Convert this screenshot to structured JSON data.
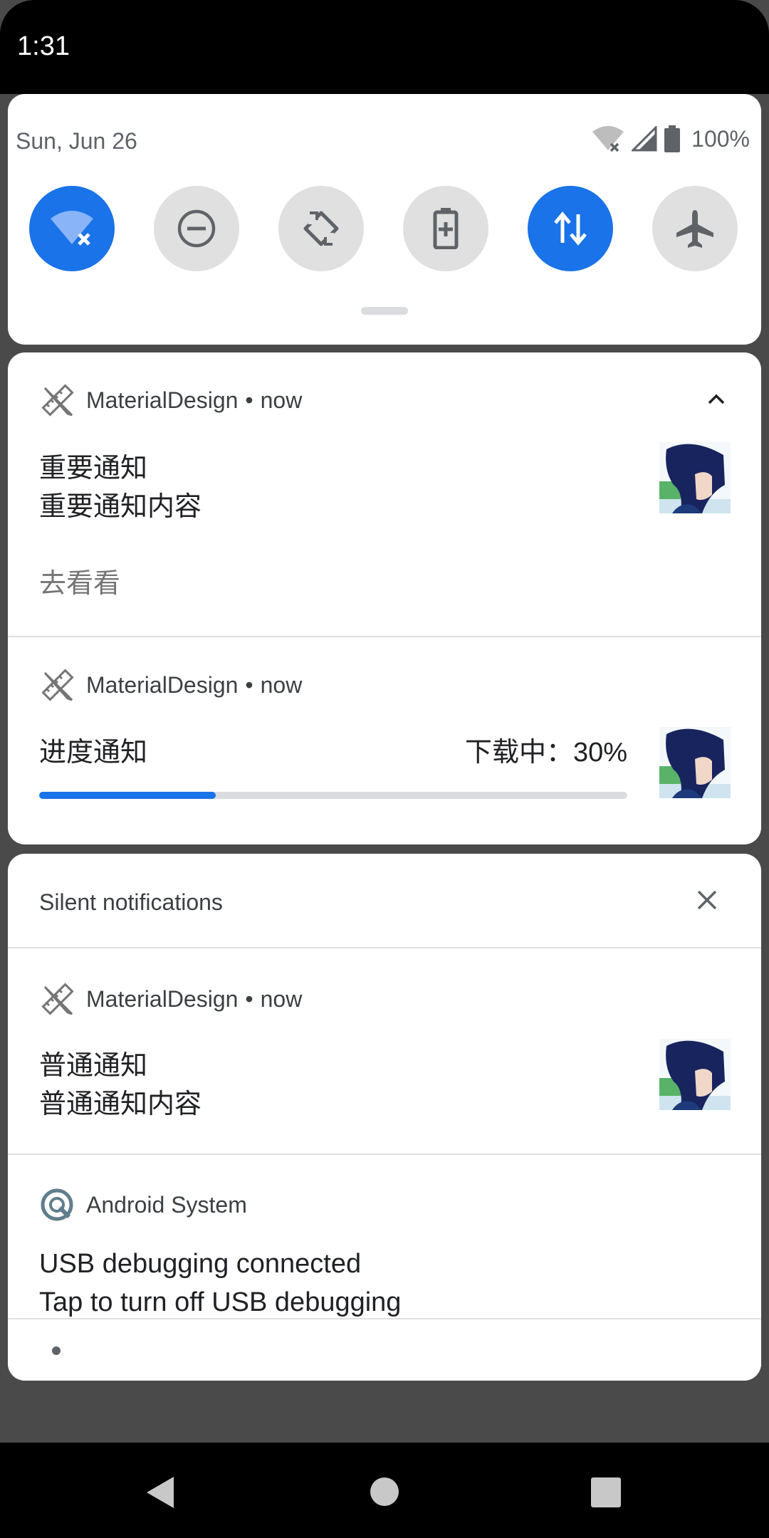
{
  "status_bar": {
    "time": "1:31"
  },
  "quick_settings": {
    "date": "Sun, Jun 26",
    "battery": "100%",
    "tiles": [
      {
        "icon": "wifi-off-icon",
        "active": true
      },
      {
        "icon": "do-not-disturb-icon",
        "active": false
      },
      {
        "icon": "auto-rotate-icon",
        "active": false
      },
      {
        "icon": "battery-saver-icon",
        "active": false
      },
      {
        "icon": "mobile-data-icon",
        "active": true
      },
      {
        "icon": "airplane-mode-icon",
        "active": false
      }
    ]
  },
  "notifications": {
    "important": {
      "app_name": "MaterialDesign",
      "time": "now",
      "title": "重要通知",
      "text": "重要通知内容",
      "action": "去看看"
    },
    "progress": {
      "app_name": "MaterialDesign",
      "time": "now",
      "title": "进度通知",
      "status": "下载中：30%",
      "progress": 0.3
    },
    "silent_header": "Silent notifications",
    "normal": {
      "app_name": "MaterialDesign",
      "time": "now",
      "title": "普通通知",
      "text": "普通通知内容"
    },
    "android": {
      "app_name": "Android System",
      "title": "USB debugging connected",
      "text": "Tap to turn off USB debugging"
    }
  },
  "colors": {
    "accent": "#1a73e8",
    "tile_off": "#e0e0e0",
    "scrim": "#4a4a4a"
  }
}
